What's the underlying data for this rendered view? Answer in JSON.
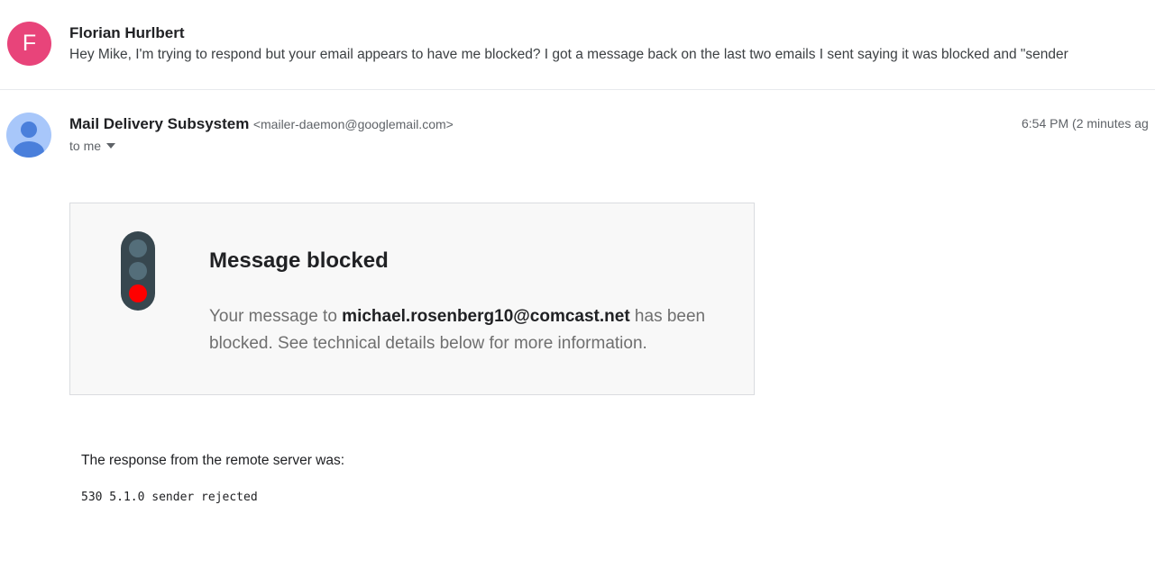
{
  "thread_item": {
    "avatar_letter": "F",
    "avatar_color": "#e8447a",
    "sender": "Florian Hurlbert",
    "snippet": "Hey Mike, I'm trying to respond but your email appears to have me blocked? I got a message back on the last two emails I sent saying it was blocked and \"sender"
  },
  "message": {
    "sender_name": "Mail Delivery Subsystem",
    "sender_email": "<mailer-daemon@googlemail.com>",
    "recipient_label": "to me",
    "timestamp": "6:54 PM (2 minutes ag",
    "avatar_icon": "person-icon"
  },
  "notice": {
    "icon": "traffic-light-icon",
    "title": "Message blocked",
    "body_prefix": "Your message to ",
    "recipient": "michael.rosenberg10@comcast.net",
    "body_suffix": " has been blocked. See technical details below for more information."
  },
  "technical": {
    "response_label": "The response from the remote server was:",
    "code": "530 5.1.0 sender rejected"
  },
  "colors": {
    "red_light": "#ff0000",
    "traffic_body": "#37474f",
    "card_bg": "#f8f8f8"
  }
}
